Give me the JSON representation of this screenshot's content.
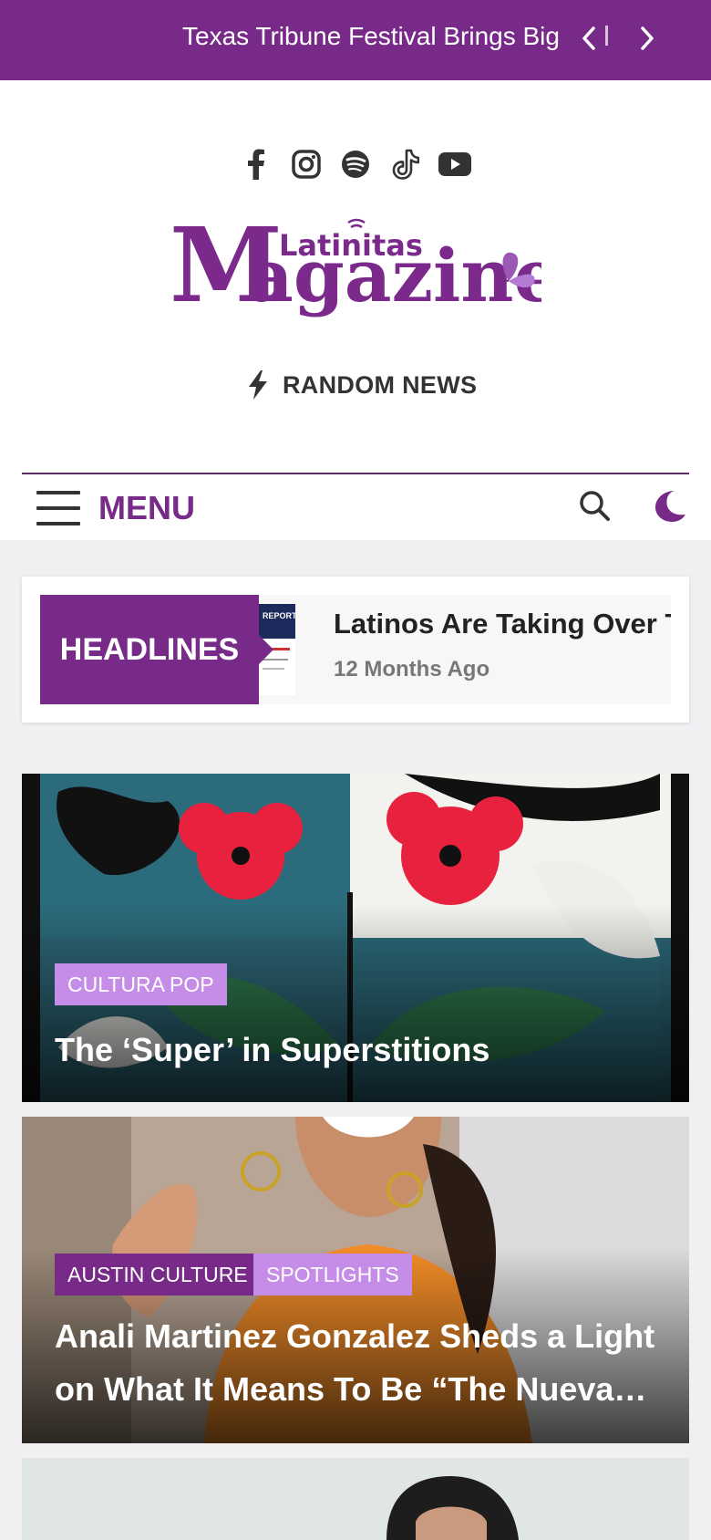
{
  "ticker": {
    "text": "Texas Tribune Festival Brings Big",
    "prev_icon": "chevron-left-icon",
    "next_icon": "chevron-right-icon"
  },
  "social": [
    "facebook-icon",
    "instagram-icon",
    "spotify-icon",
    "tiktok-icon",
    "youtube-icon"
  ],
  "logo": {
    "small": "Latinitas",
    "big_letter": "M",
    "big_rest": "agazine"
  },
  "random_news": {
    "label": "RANDOM NEWS",
    "icon": "bolt-icon"
  },
  "nav": {
    "menu_label": "MENU"
  },
  "headlines": {
    "label": "HEADLINES",
    "thumb_text": "REPORT:",
    "title": "Latinos Are Taking Over Texas",
    "time": "12 Months Ago"
  },
  "posts": [
    {
      "categories": [
        "CULTURA POP"
      ],
      "title": "The ‘Super’ in Superstitions"
    },
    {
      "categories": [
        "AUSTIN CULTURE",
        "SPOTLIGHTS"
      ],
      "title": "Anali Martinez Gonzalez Sheds a Light on What It Means To Be “The Nueva…"
    }
  ],
  "colors": {
    "brand": "#782a88",
    "accent": "#c58ce8"
  }
}
